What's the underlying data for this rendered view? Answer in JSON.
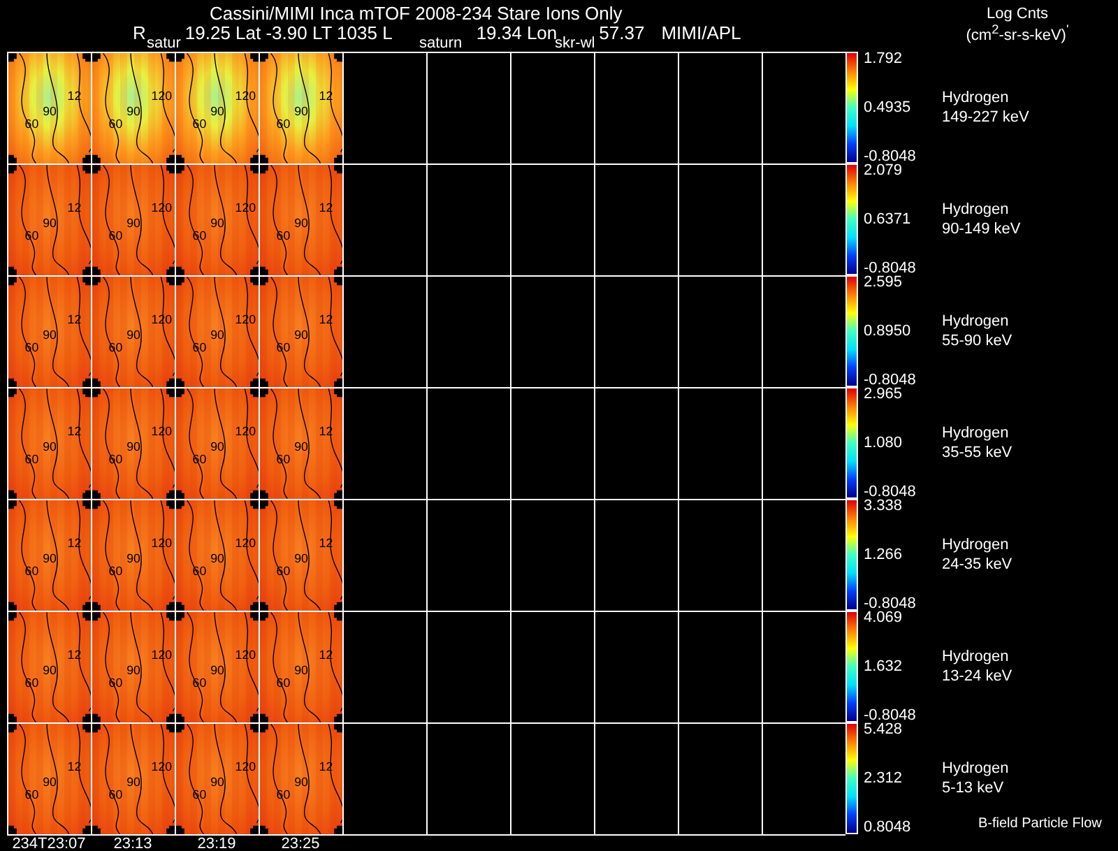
{
  "title": "Cassini/MIMI Inca mTOF  2008-234   Stare   Ions Only",
  "info": [
    "R",
    "19.25 Lat -3.90 LT 1035 L",
    "19.34 Lon",
    "57.37",
    "MIMI/APL"
  ],
  "units": {
    "name": "Log Cnts",
    "expression": "(cm$^{2}$-sr-s-keV)$^{'}$"
  },
  "overlay_labels": [
    "satur",
    "saturn",
    "skr-wl"
  ],
  "rows": [
    {
      "species": "Hydrogen",
      "energy": "149-227 keV",
      "max": "1.792",
      "mid": "0.4935",
      "min": "-0.8048",
      "maps": [
        {
          "contours": [
            "60",
            "90",
            "12"
          ]
        },
        {
          "contours": [
            "60",
            "90",
            "120"
          ]
        },
        {
          "contours": [
            "60",
            "90",
            "120"
          ]
        },
        {
          "contours": [
            "60",
            "90",
            "12"
          ]
        }
      ]
    },
    {
      "species": "Hydrogen",
      "energy": "90-149 keV",
      "max": "2.079",
      "mid": "0.6371",
      "min": "-0.8048",
      "maps": [
        {
          "contours": [
            "60",
            "90",
            "12"
          ]
        },
        {
          "contours": [
            "60",
            "90",
            "120"
          ]
        },
        {
          "contours": [
            "60",
            "90",
            "120"
          ]
        },
        {
          "contours": [
            "60",
            "90",
            "12"
          ]
        }
      ]
    },
    {
      "species": "Hydrogen",
      "energy": "55-90 keV",
      "max": "2.595",
      "mid": "0.8950",
      "min": "-0.8048",
      "maps": [
        {
          "contours": [
            "60",
            "90",
            "12"
          ]
        },
        {
          "contours": [
            "60",
            "90",
            "120"
          ]
        },
        {
          "contours": [
            "60",
            "90",
            "120"
          ]
        },
        {
          "contours": [
            "60",
            "90",
            "12"
          ]
        }
      ]
    },
    {
      "species": "Hydrogen",
      "energy": "35-55 keV",
      "max": "2.965",
      "mid": "1.080",
      "min": "-0.8048",
      "maps": [
        {
          "contours": [
            "60",
            "90",
            "12"
          ]
        },
        {
          "contours": [
            "60",
            "90",
            "120"
          ]
        },
        {
          "contours": [
            "60",
            "90",
            "120"
          ]
        },
        {
          "contours": [
            "60",
            "90",
            "12"
          ]
        }
      ]
    },
    {
      "species": "Hydrogen",
      "energy": "24-35 keV",
      "max": "3.338",
      "mid": "1.266",
      "min": "-0.8048",
      "maps": [
        {
          "contours": [
            "60",
            "90",
            "12"
          ]
        },
        {
          "contours": [
            "60",
            "90",
            "120"
          ]
        },
        {
          "contours": [
            "60",
            "90",
            "120"
          ]
        },
        {
          "contours": [
            "60",
            "90",
            "12"
          ]
        }
      ]
    },
    {
      "species": "Hydrogen",
      "energy": "13-24 keV",
      "max": "4.069",
      "mid": "1.632",
      "min": "-0.8048",
      "maps": [
        {
          "contours": [
            "60",
            "90",
            "12"
          ]
        },
        {
          "contours": [
            "60",
            "90",
            "120"
          ]
        },
        {
          "contours": [
            "60",
            "90",
            "120"
          ]
        },
        {
          "contours": [
            "60",
            "90",
            "12"
          ]
        }
      ]
    },
    {
      "species": "Hydrogen",
      "energy": "5-13 keV",
      "max": "5.428",
      "mid": "2.312",
      "min": "0.8048",
      "maps": [
        {
          "contours": [
            "60",
            "90",
            "12"
          ]
        },
        {
          "contours": [
            "60",
            "90",
            "120"
          ]
        },
        {
          "contours": [
            "60",
            "90",
            "120"
          ]
        },
        {
          "contours": [
            "60",
            "90",
            "12"
          ]
        }
      ]
    }
  ],
  "times": [
    "234T23:07",
    "23:13",
    "23:19",
    "23:25"
  ],
  "footer": "B-field Particle Flow"
}
